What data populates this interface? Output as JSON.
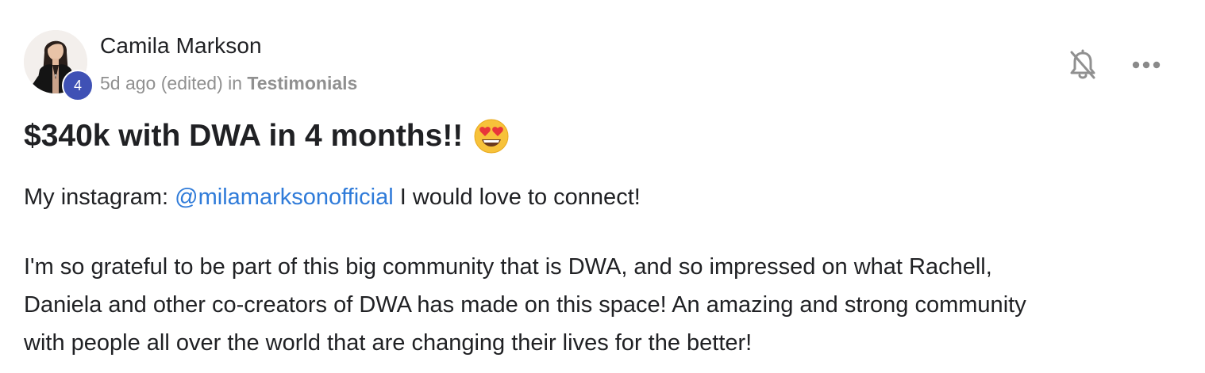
{
  "post": {
    "author": {
      "name": "Camila Markson",
      "level": "4",
      "avatar_icon": "profile-photo"
    },
    "meta": {
      "time": "5d ago",
      "edited": "(edited)",
      "in_word": "in",
      "category": "Testimonials"
    },
    "actions": {
      "notification_icon": "bell-off-icon",
      "more_icon": "more-horizontal-icon"
    },
    "title": {
      "text": "$340k with DWA in 4 months!!",
      "emoji": "heart-eyes-emoji"
    },
    "instagram": {
      "prefix": "My instagram:",
      "handle": "@milamarksonofficial",
      "suffix": "I would love to connect!"
    },
    "body_lines": [
      "I'm so grateful to be part of this big community that is DWA, and so impressed on what Rachell,",
      "Daniela and other co-creators of DWA has made on this space! An amazing and strong community",
      "with people all over the world that are changing their lives for the better!"
    ]
  },
  "colors": {
    "badge": "#3f51b5",
    "link": "#2f7bd9",
    "meta_text": "#909090",
    "primary_text": "#202124"
  }
}
